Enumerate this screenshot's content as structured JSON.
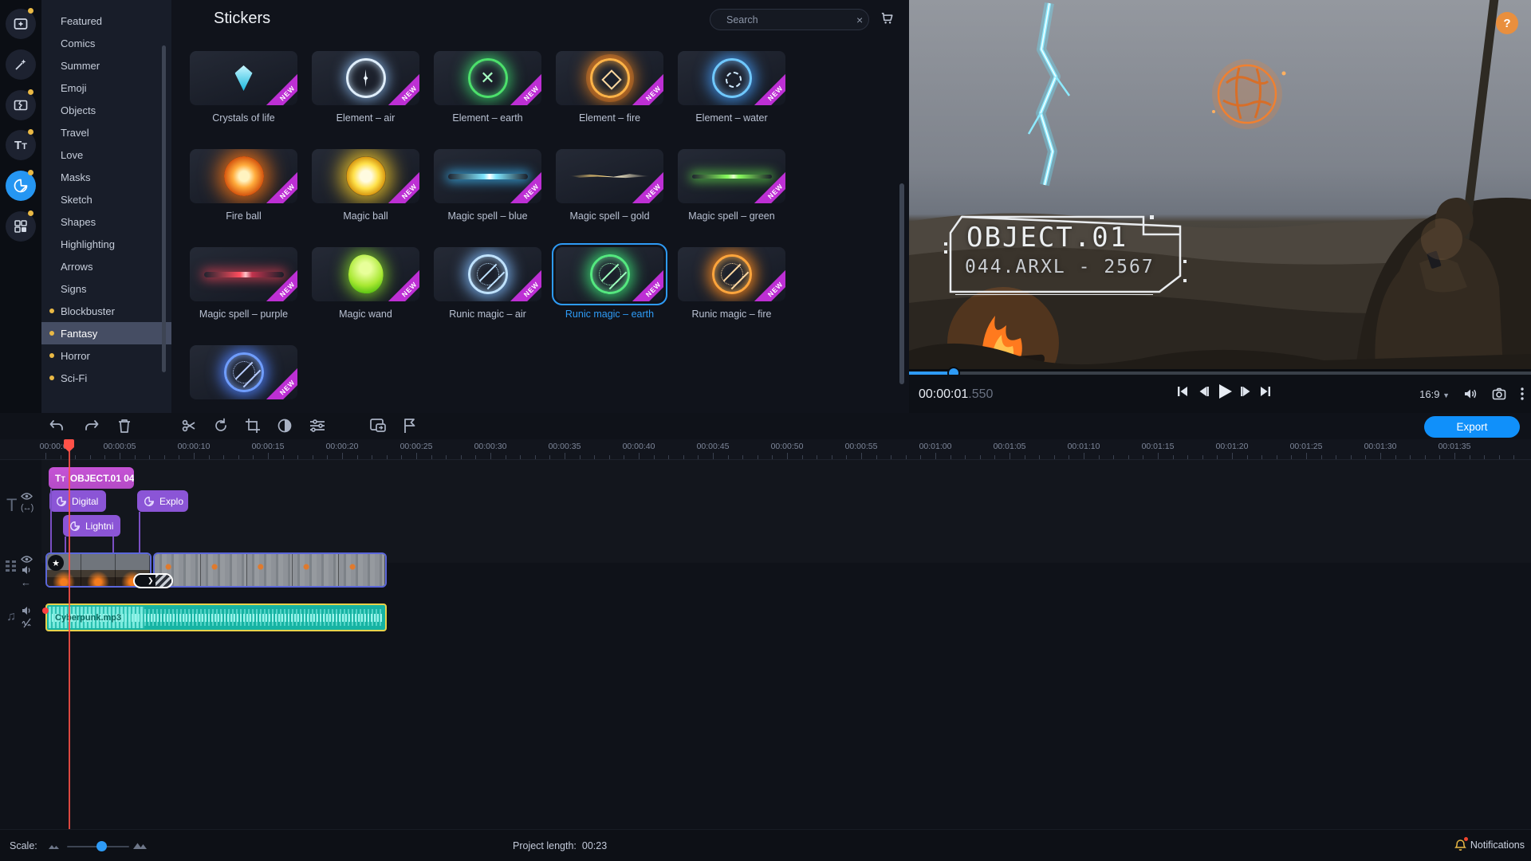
{
  "icon_rail": {
    "active_tool": "stickers",
    "tools": [
      "import-media",
      "filters",
      "transitions",
      "titles",
      "stickers",
      "more-tools"
    ]
  },
  "categories": {
    "items": [
      {
        "label": "Featured",
        "dot": false,
        "selected": false
      },
      {
        "label": "Comics",
        "dot": false,
        "selected": false
      },
      {
        "label": "Summer",
        "dot": false,
        "selected": false
      },
      {
        "label": "Emoji",
        "dot": false,
        "selected": false
      },
      {
        "label": "Objects",
        "dot": false,
        "selected": false
      },
      {
        "label": "Travel",
        "dot": false,
        "selected": false
      },
      {
        "label": "Love",
        "dot": false,
        "selected": false
      },
      {
        "label": "Masks",
        "dot": false,
        "selected": false
      },
      {
        "label": "Sketch",
        "dot": false,
        "selected": false
      },
      {
        "label": "Shapes",
        "dot": false,
        "selected": false
      },
      {
        "label": "Highlighting",
        "dot": false,
        "selected": false
      },
      {
        "label": "Arrows",
        "dot": false,
        "selected": false
      },
      {
        "label": "Signs",
        "dot": false,
        "selected": false
      },
      {
        "label": "Blockbuster",
        "dot": true,
        "selected": false
      },
      {
        "label": "Fantasy",
        "dot": true,
        "selected": true
      },
      {
        "label": "Horror",
        "dot": true,
        "selected": false
      },
      {
        "label": "Sci-Fi",
        "dot": true,
        "selected": false
      }
    ]
  },
  "stickers": {
    "panel_title": "Stickers",
    "search_placeholder": "Search",
    "badge_label": "NEW",
    "items": [
      {
        "label": "Crystals of life",
        "art": "crystal",
        "selected": false
      },
      {
        "label": "Element – air",
        "art": "air",
        "selected": false
      },
      {
        "label": "Element – earth",
        "art": "earth",
        "selected": false
      },
      {
        "label": "Element – fire",
        "art": "fire",
        "selected": false
      },
      {
        "label": "Element – water",
        "art": "water",
        "selected": false
      },
      {
        "label": "Fire ball",
        "art": "fireball",
        "selected": false
      },
      {
        "label": "Magic ball",
        "art": "magicball",
        "selected": false
      },
      {
        "label": "Magic spell – blue",
        "art": "spell-blue",
        "selected": false
      },
      {
        "label": "Magic spell – gold",
        "art": "spell-gold",
        "selected": false
      },
      {
        "label": "Magic spell – green",
        "art": "spell-green",
        "selected": false
      },
      {
        "label": "Magic spell – purple",
        "art": "spell-purple",
        "selected": false
      },
      {
        "label": "Magic wand",
        "art": "wand",
        "selected": false
      },
      {
        "label": "Runic magic – air",
        "art": "runic-air",
        "selected": false
      },
      {
        "label": "Runic magic – earth",
        "art": "runic-earth",
        "selected": true
      },
      {
        "label": "Runic magic – fire",
        "art": "runic-fire",
        "selected": false
      },
      {
        "label": "",
        "art": "runic-blue",
        "selected": false
      }
    ]
  },
  "preview": {
    "overlay_title": "OBJECT.01",
    "overlay_subtitle": "044.ARXL - 2567",
    "timecode": "00:00:01",
    "timecode_ms": ".550",
    "aspect_ratio": "16:9",
    "help_label": "?"
  },
  "timeline": {
    "export_label": "Export",
    "ruler_ticks": [
      "00:00:00",
      "00:00:05",
      "00:00:10",
      "00:00:15",
      "00:00:20",
      "00:00:25",
      "00:00:30",
      "00:00:35",
      "00:00:40",
      "00:00:45",
      "00:00:50",
      "00:00:55",
      "00:01:00",
      "00:01:05",
      "00:01:10",
      "00:01:15",
      "00:01:20",
      "00:01:25",
      "00:01:30",
      "00:01:35"
    ],
    "clips": {
      "title": "OBJECT.01 04",
      "sticker_1": "Digital",
      "sticker_2": "Explo",
      "sticker_3": "Lightni",
      "audio": "Cyberpunk.mp3"
    }
  },
  "statusbar": {
    "scale_label": "Scale:",
    "project_length_label": "Project length:",
    "project_length_value": "00:23",
    "notifications_label": "Notifications"
  },
  "colors": {
    "accent_blue": "#2e9bf6",
    "export_blue": "#1090fa",
    "new_badge_magenta": "#bd2fd4",
    "category_dot_yellow": "#eab945",
    "audio_clip_teal": "#16b3a3",
    "audio_selection_yellow": "#e7d24b",
    "sticker_clip_purple": "#8b55d6",
    "title_clip_pink": "#c653d6",
    "playhead_red": "#ff5148",
    "help_orange": "#e98f3e"
  }
}
